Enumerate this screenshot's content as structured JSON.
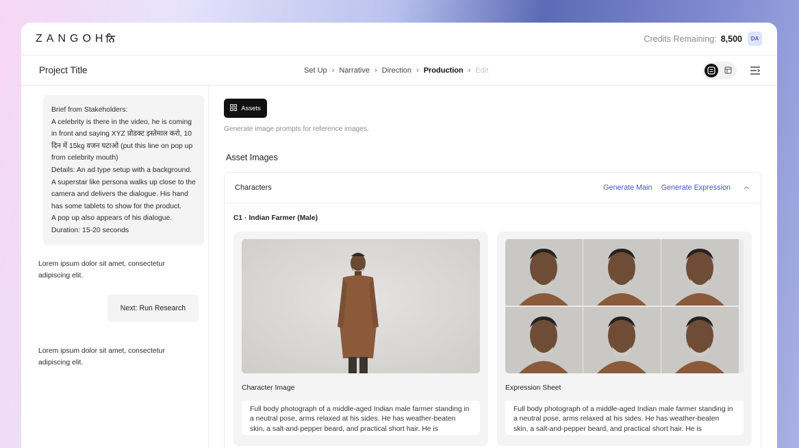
{
  "brand": {
    "logo": "ZANGOH",
    "logo_suffix": "ਨਿ"
  },
  "header": {
    "credits_label": "Credits Remaining:",
    "credits_value": "8,500",
    "avatar": "DA"
  },
  "project": {
    "title": "Project Title"
  },
  "breadcrumb": [
    "Set Up",
    "Narrative",
    "Direction",
    "Production",
    "Edit"
  ],
  "sidebar": {
    "brief_lines": [
      "Brief from Stakeholders:",
      "A celebrity is there in the video, he is coming in front and saying XYZ प्रोडक्ट इस्तेमाल करो, 10 दिन में 15kg वजन घटाओ (put this line on pop up from celebrity mouth)",
      "Details: An ad type setup with a background. A superstar like persona walks up close to the camera and delivers the dialogue. His hand has some tablets to show for the product.",
      "A pop up also appears of his dialogue.",
      "Duration: 15-20 seconds"
    ],
    "message_1": "Lorem ipsum dolor sit amet, consectetur adipiscing elit.",
    "next_button": "Next: Run Research",
    "message_2": "Lorem ipsum dolor sit amet, consectetur adipiscing elit."
  },
  "content": {
    "assets_button": "Assets",
    "hint": "Generate image prompts for reference images.",
    "section_title": "Asset Images",
    "card": {
      "label": "Characters",
      "generate_main": "Generate Main",
      "generate_expression": "Generate Expression",
      "character_name": "C1 · Indian Farmer (Male)",
      "panels": [
        {
          "title": "Character Image",
          "prompt": "Full body photograph of a middle-aged Indian male farmer standing in a neutral pose, arms relaxed at his sides. He has weather-beaten skin, a salt-and-pepper beard, and practical short hair. He is"
        },
        {
          "title": "Expression Sheet",
          "prompt": "Full body photograph of a middle-aged Indian male farmer standing in a neutral pose, arms relaxed at his sides. He has weather-beaten skin, a salt-and-pepper beard, and practical short hair. He is"
        }
      ]
    }
  },
  "colors": {
    "accent": "#4a55c8",
    "dark": "#111111",
    "panel": "#f4f4f4"
  }
}
